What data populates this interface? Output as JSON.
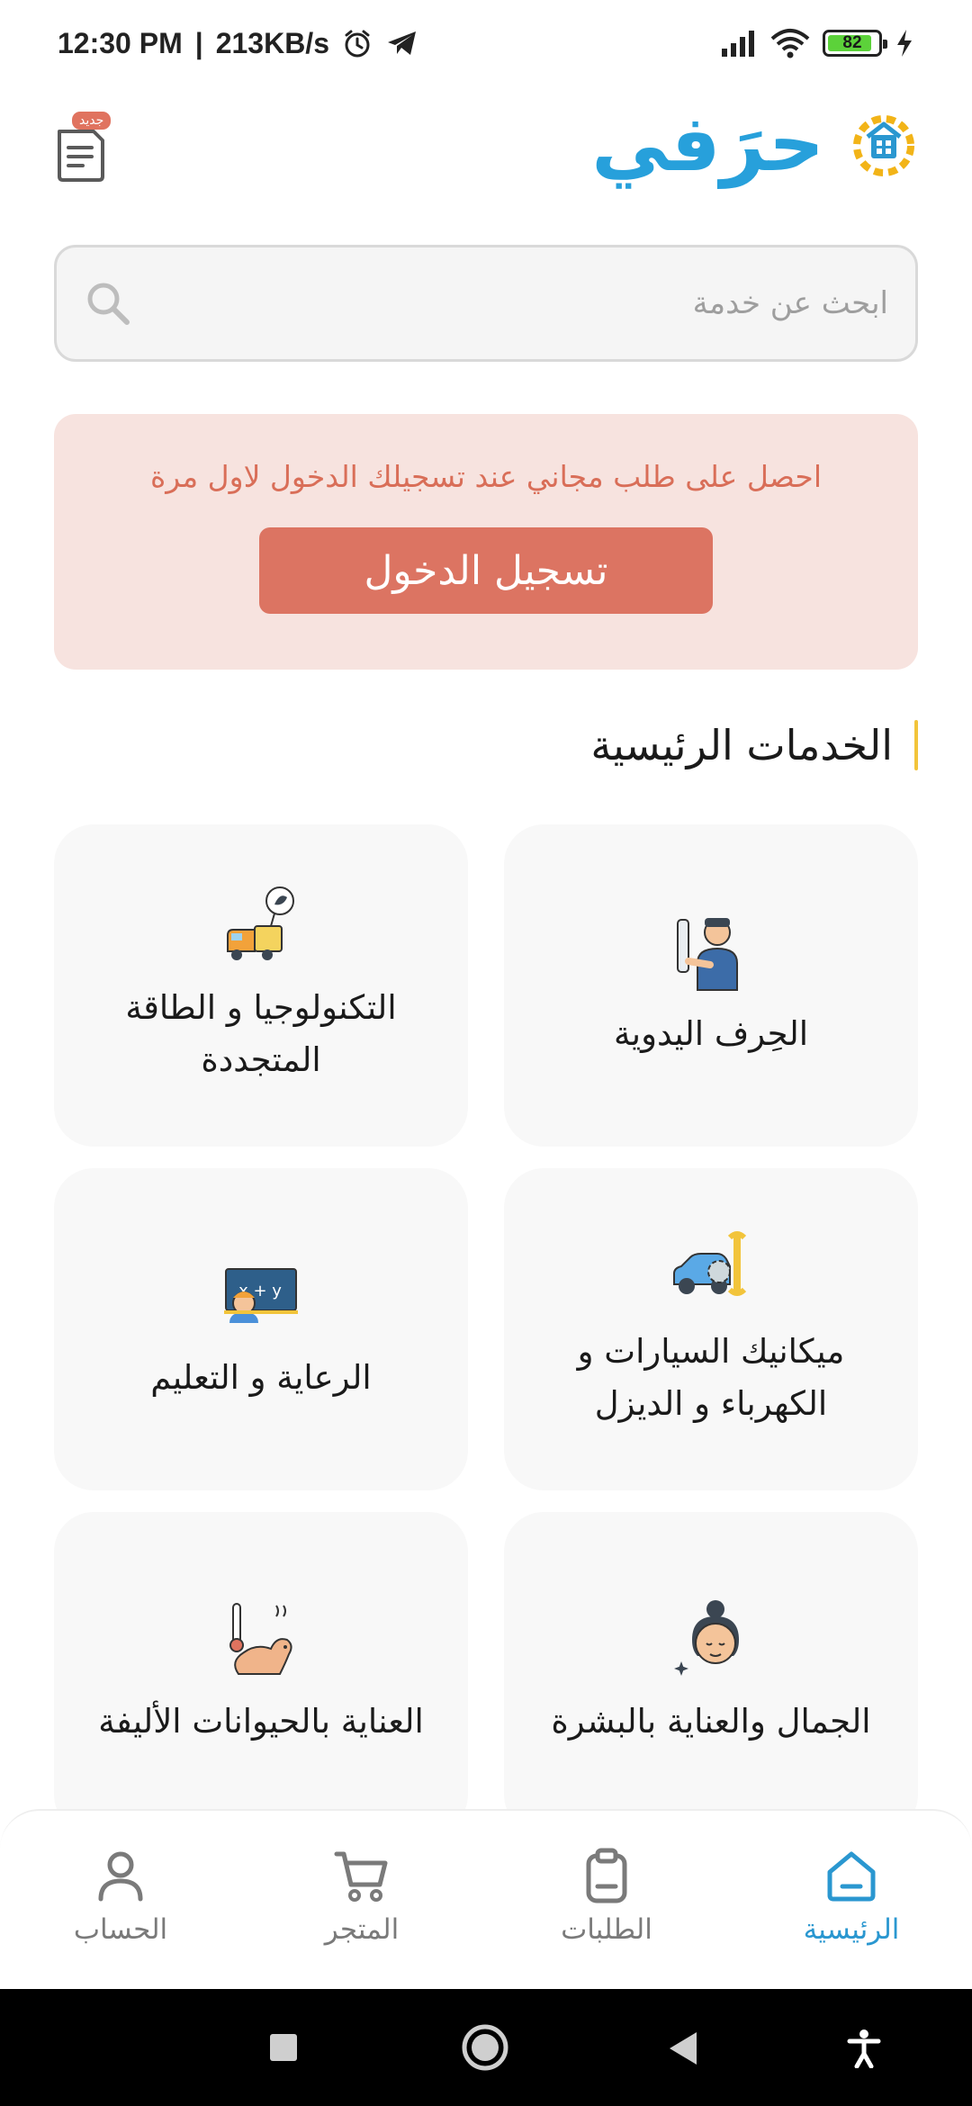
{
  "status_bar": {
    "time": "12:30 PM",
    "separator": "|",
    "speed": "213KB/s",
    "battery": "82"
  },
  "header": {
    "logo_text": "حرَفي",
    "new_badge": "جديد",
    "icons": [
      "notes-icon",
      "app-logo-icon"
    ]
  },
  "search": {
    "placeholder": "ابحث عن خدمة",
    "icon": "search-icon"
  },
  "promo": {
    "text": "احصل على طلب مجاني عند تسجيلك الدخول لاول مرة",
    "button_label": "تسجيل الدخول"
  },
  "section": {
    "title": "الخدمات الرئيسية"
  },
  "services": [
    {
      "label": "الحِرف اليدوية",
      "icon": "craftsman-icon"
    },
    {
      "label": "التكنولوجيا و الطاقة المتجددة",
      "icon": "tech-energy-icon"
    },
    {
      "label": "ميكانيك السيارات و الكهرباء و الديزل",
      "icon": "car-mechanic-icon"
    },
    {
      "label": "الرعاية و التعليم",
      "icon": "teacher-board-icon"
    },
    {
      "label": "الجمال والعناية بالبشرة",
      "icon": "beauty-face-icon"
    },
    {
      "label": "العناية بالحيوانات الأليفة",
      "icon": "pet-care-icon"
    }
  ],
  "bottom_nav": {
    "items": [
      {
        "label": "الرئيسية",
        "icon": "home-icon",
        "active": true
      },
      {
        "label": "الطلبات",
        "icon": "clipboard-icon",
        "active": false
      },
      {
        "label": "المتجر",
        "icon": "cart-icon",
        "active": false
      },
      {
        "label": "الحساب",
        "icon": "user-icon",
        "active": false
      }
    ]
  },
  "colors": {
    "accent": "#2a97d0",
    "promo_bg": "#f7e3df",
    "promo_button": "#dc7462",
    "section_bar": "#f2c43b"
  }
}
